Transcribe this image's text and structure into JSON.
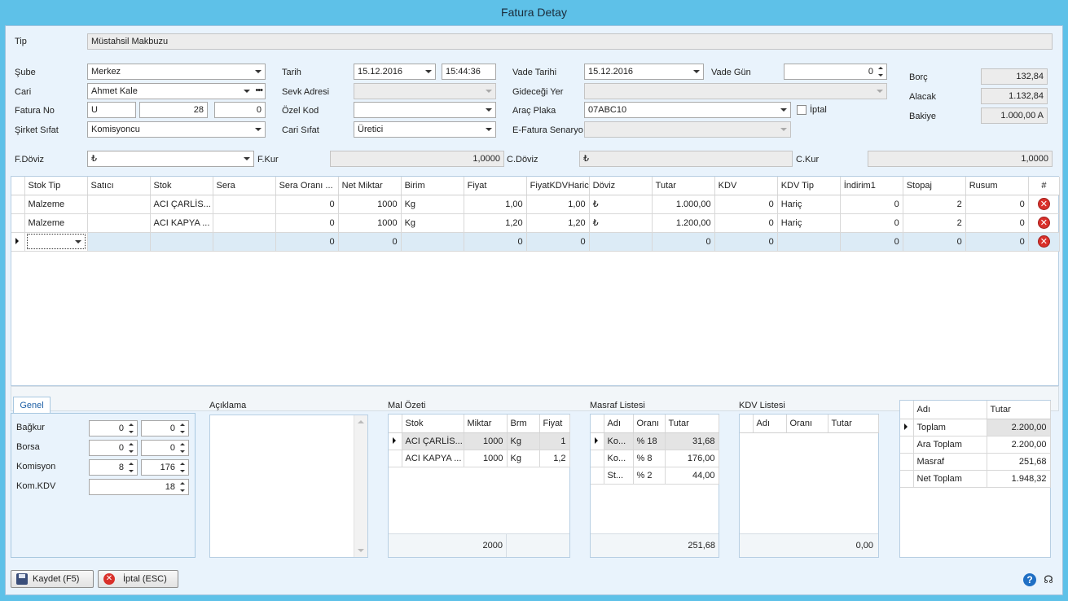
{
  "window": {
    "title": "Fatura Detay"
  },
  "header": {
    "tip": {
      "label": "Tip",
      "value": "Müstahsil Makbuzu"
    },
    "sube": {
      "label": "Şube",
      "value": "Merkez"
    },
    "cari": {
      "label": "Cari",
      "value": "Ahmet Kale"
    },
    "fatura_no": {
      "label": "Fatura No",
      "series": "U",
      "number": "28",
      "extra": "0"
    },
    "sirket_sifat": {
      "label": "Şirket Sıfat",
      "value": "Komisyoncu"
    },
    "tarih": {
      "label": "Tarih",
      "date": "15.12.2016",
      "time": "15:44:36"
    },
    "sevk_adresi": {
      "label": "Sevk Adresi",
      "value": ""
    },
    "ozel_kod": {
      "label": "Özel Kod",
      "value": ""
    },
    "cari_sifat": {
      "label": "Cari Sıfat",
      "value": "Üretici"
    },
    "vade_tarihi": {
      "label": "Vade Tarihi",
      "value": "15.12.2016"
    },
    "vade_gun": {
      "label": "Vade Gün",
      "value": "0"
    },
    "gidecegi_yer": {
      "label": "Gideceği Yer",
      "value": ""
    },
    "arac_plaka": {
      "label": "Araç Plaka",
      "value": "07ABC10"
    },
    "iptal": {
      "label": "İptal",
      "checked": false
    },
    "efatura_senaryo": {
      "label": "E-Fatura Senaryo",
      "value": ""
    },
    "borc": {
      "label": "Borç",
      "value": "132,84"
    },
    "alacak": {
      "label": "Alacak",
      "value": "1.132,84"
    },
    "bakiye": {
      "label": "Bakiye",
      "value": "1.000,00 A"
    },
    "f_doviz": {
      "label": "F.Döviz",
      "value": "₺"
    },
    "f_kur": {
      "label": "F.Kur",
      "value": "1,0000"
    },
    "c_doviz": {
      "label": "C.Döviz",
      "value": "₺"
    },
    "c_kur": {
      "label": "C.Kur",
      "value": "1,0000"
    }
  },
  "grid": {
    "columns": [
      "Stok Tip",
      "Satıcı",
      "Stok",
      "Sera",
      "Sera Oranı ...",
      "Net Miktar",
      "Birim",
      "Fiyat",
      "FiyatKDVHaric",
      "Döviz",
      "Tutar",
      "KDV",
      "KDV Tip",
      "İndirim1",
      "Stopaj",
      "Rusum",
      "#"
    ],
    "rows": [
      [
        "Malzeme",
        "",
        "ACI ÇARLİS...",
        "",
        "0",
        "1000",
        "Kg",
        "1,00",
        "1,00",
        "₺",
        "1.000,00",
        "0",
        "Hariç",
        "0",
        "2",
        "0"
      ],
      [
        "Malzeme",
        "",
        "ACI KAPYA ...",
        "",
        "0",
        "1000",
        "Kg",
        "1,20",
        "1,20",
        "₺",
        "1.200,00",
        "0",
        "Hariç",
        "0",
        "2",
        "0"
      ],
      [
        "",
        "",
        "",
        "",
        "0",
        "0",
        "",
        "0",
        "0",
        "",
        "0",
        "0",
        "",
        "0",
        "0",
        "0"
      ]
    ]
  },
  "genel": {
    "tab_label": "Genel",
    "bagkur": {
      "label": "Bağkur",
      "v1": "0",
      "v2": "0"
    },
    "borsa": {
      "label": "Borsa",
      "v1": "0",
      "v2": "0"
    },
    "komisyon": {
      "label": "Komisyon",
      "v1": "8",
      "v2": "176"
    },
    "kom_kdv": {
      "label": "Kom.KDV",
      "v1": "18"
    }
  },
  "aciklama": {
    "label": "Açıklama",
    "value": ""
  },
  "mal_ozeti": {
    "label": "Mal Özeti",
    "columns": [
      "Stok",
      "Miktar",
      "Brm",
      "Fiyat"
    ],
    "rows": [
      [
        "ACI ÇARLİS...",
        "1000",
        "Kg",
        "1"
      ],
      [
        "ACI KAPYA ...",
        "1000",
        "Kg",
        "1,2"
      ]
    ],
    "footer_total": "2000"
  },
  "masraf_listesi": {
    "label": "Masraf Listesi",
    "columns": [
      "Adı",
      "Oranı",
      "Tutar"
    ],
    "rows": [
      [
        "Ko...",
        "% 18",
        "31,68"
      ],
      [
        "Ko...",
        "% 8",
        "176,00"
      ],
      [
        "St...",
        "% 2",
        "44,00"
      ]
    ],
    "footer_total": "251,68"
  },
  "kdv_listesi": {
    "label": "KDV Listesi",
    "columns": [
      "Adı",
      "Oranı",
      "Tutar"
    ],
    "rows": [],
    "footer_total": "0,00"
  },
  "totals": {
    "columns": [
      "Adı",
      "Tutar"
    ],
    "rows": [
      [
        "Toplam",
        "2.200,00"
      ],
      [
        "Ara Toplam",
        "2.200,00"
      ],
      [
        "Masraf",
        "251,68"
      ],
      [
        "Net Toplam",
        "1.948,32"
      ]
    ]
  },
  "buttons": {
    "save": "Kaydet (F5)",
    "cancel": "İptal (ESC)"
  },
  "icons": {
    "help": "help-icon",
    "support": "headset-icon"
  },
  "colors": {
    "titlebar": "#5ec1e8",
    "client": "#e9f3fc",
    "delete": "#d9302a",
    "selected_row": "#dcebf6"
  }
}
